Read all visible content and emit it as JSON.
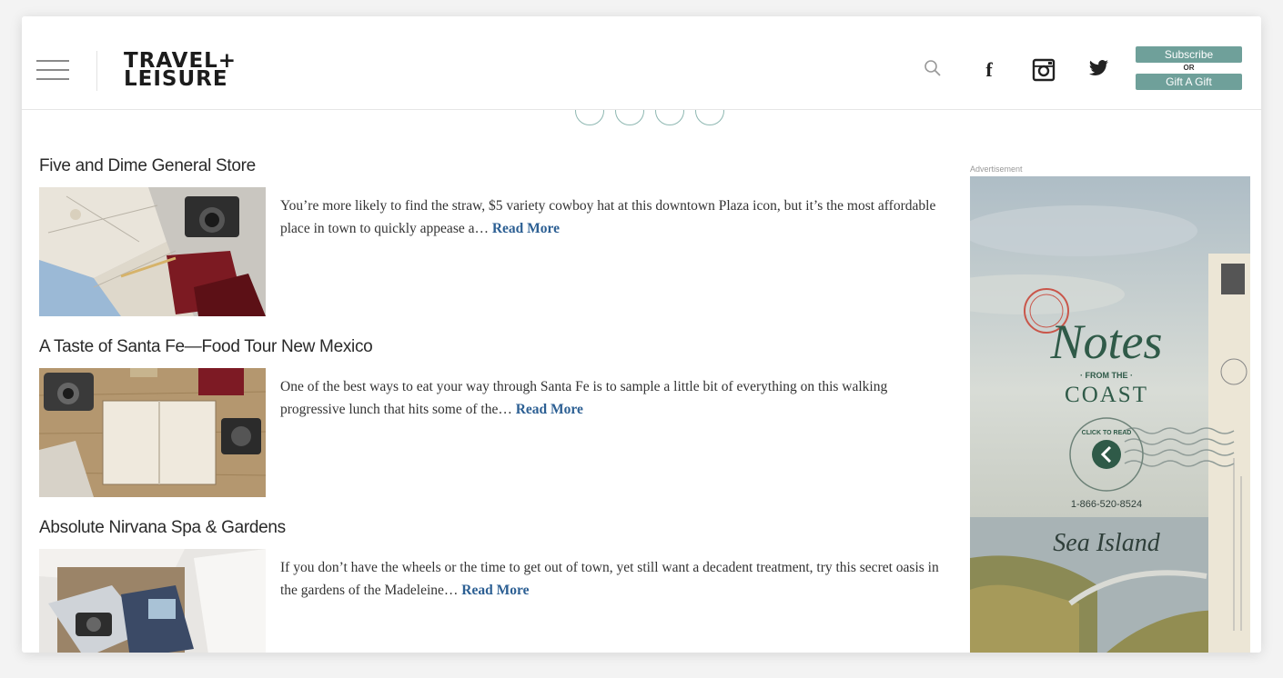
{
  "header": {
    "logo_line1": "TRAVEL+",
    "logo_line2": "LEISURE",
    "subscribe_label": "Subscribe",
    "or_label": "OR",
    "gift_label": "Gift A Gift",
    "facebook_glyph": "f",
    "icons": [
      "menu-icon",
      "search-icon",
      "facebook-icon",
      "instagram-icon",
      "twitter-icon"
    ]
  },
  "share": {
    "icons": [
      "facebook-share-icon",
      "pinterest-share-icon",
      "googleplus-share-icon",
      "email-share-icon"
    ]
  },
  "articles": [
    {
      "title": "Five and Dime General Store",
      "text": "You’re more likely to find the straw, $5 variety cowboy hat at this downtown Plaza icon, but it’s the most affordable place in town to quickly appease a…",
      "more": "Read More"
    },
    {
      "title": "A Taste of Santa Fe—Food Tour New Mexico",
      "text": "One of the best ways to eat your way through Santa Fe is to sample a little bit of everything on this walking progressive lunch that hits some of the…",
      "more": "Read More"
    },
    {
      "title": "Absolute Nirvana Spa & Gardens",
      "text": "If you don’t have the wheels or the time to get out of town, yet still want a decadent treatment, try this secret oasis in the gardens of the Madeleine…",
      "more": "Read More"
    }
  ],
  "ad": {
    "label": "Advertisement",
    "title_script": "Notes",
    "title_from": "· FROM THE ·",
    "title_coast": "COAST",
    "click_text": "CLICK TO READ",
    "phone": "1-866-520-8524",
    "brand": "Sea Island"
  },
  "colors": {
    "accent_teal": "#6fa09a",
    "link_blue": "#2c5f93",
    "ad_green": "#2f5a48"
  }
}
